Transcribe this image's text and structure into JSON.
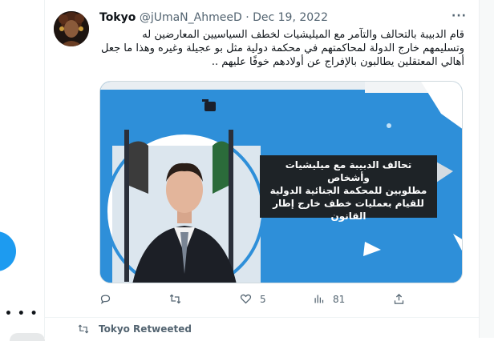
{
  "tweet": {
    "display_name": "Tokyo",
    "handle": "@jUmaN_AhmeeD",
    "separator": "·",
    "date": "Dec 19, 2022",
    "text_lines": [
      "قام الدبيبة بالتحالف والتآمر مع الميليشيات لخطف السياسيين المعارضين له",
      "وتسليمهم خارج الدولة لمحاكمتهم في محكمة دولية مثل بو عجيلة وغيره وهذا ما جعل",
      "أهالي المعتقلين يطالبون بالإفراج عن أولادهم خوفًا عليهم .."
    ],
    "media": {
      "caption_lines": [
        "تحالف الدبيبة مع ميليشيات وأشخاص",
        "مطلوبين للمحكمة الجنائية الدولية",
        "للقيام بعمليات خطف خارج إطار",
        "القانون"
      ],
      "accent_color": "#2e8fd9"
    },
    "actions": {
      "reply_icon": "reply-icon",
      "retweet_icon": "retweet-icon",
      "like_icon": "heart-icon",
      "like_count": "5",
      "views_icon": "views-icon",
      "view_count": "81",
      "share_icon": "share-icon"
    }
  },
  "next_item": {
    "retweet_label": "Tokyo Retweeted",
    "icon": "retweet-icon"
  },
  "sidebar": {
    "more_icon": "more-dots-icon"
  },
  "colors": {
    "brand_blue": "#1d9bf0",
    "secondary_text": "#536471",
    "media_background": "#2e8fd9",
    "caption_background": "#1e2327"
  }
}
